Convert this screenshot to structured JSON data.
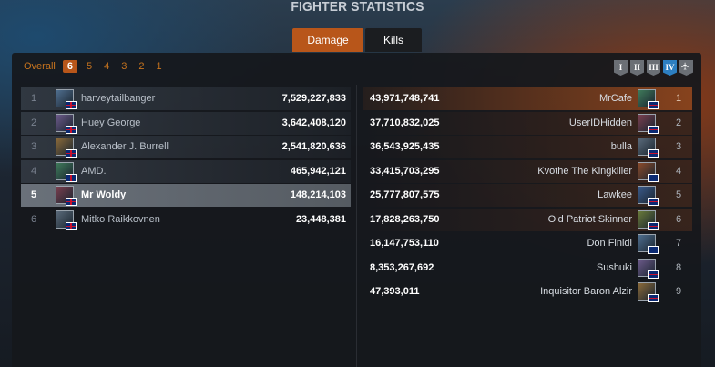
{
  "header": {
    "title": "FIGHTER STATISTICS"
  },
  "tabs": [
    {
      "label": "Damage",
      "active": true
    },
    {
      "label": "Kills",
      "active": false
    }
  ],
  "filters": {
    "overall": "Overall",
    "levels": [
      "6",
      "5",
      "4",
      "3",
      "2",
      "1"
    ],
    "selected": "6"
  },
  "tiers": [
    "I",
    "II",
    "III",
    "IV"
  ],
  "tier_selected": "IV",
  "left_list": [
    {
      "rank": "1",
      "name": "harveytailbanger",
      "value": "7,529,227,833",
      "flag": "uk-flag"
    },
    {
      "rank": "2",
      "name": "Huey George",
      "value": "3,642,408,120",
      "flag": "uk-flag"
    },
    {
      "rank": "3",
      "name": "Alexander J. Burrell",
      "value": "2,541,820,636",
      "flag": "uk-flag"
    },
    {
      "rank": "4",
      "name": "AMD.",
      "value": "465,942,121",
      "flag": "uk-flag"
    },
    {
      "rank": "5",
      "name": "Mr Woldy",
      "value": "148,214,103",
      "flag": "uk-flag",
      "highlighted": true
    },
    {
      "rank": "6",
      "name": "Mitko Raikkovnen",
      "value": "23,448,381",
      "flag": "uk-flag"
    }
  ],
  "right_list": [
    {
      "rank": "1",
      "name": "MrCafe",
      "value": "43,971,748,741",
      "flag": "au-flag"
    },
    {
      "rank": "2",
      "name": "UserIDHidden",
      "value": "37,710,832,025",
      "flag": "au-flag"
    },
    {
      "rank": "3",
      "name": "bulla",
      "value": "36,543,925,435",
      "flag": "au-flag"
    },
    {
      "rank": "4",
      "name": "Kvothe The Kingkiller",
      "value": "33,415,703,295",
      "flag": "au-flag"
    },
    {
      "rank": "5",
      "name": "Lawkee",
      "value": "25,777,807,575",
      "flag": "au-flag"
    },
    {
      "rank": "6",
      "name": "Old Patriot Skinner",
      "value": "17,828,263,750",
      "flag": "au-flag"
    },
    {
      "rank": "7",
      "name": "Don Finidi",
      "value": "16,147,753,110",
      "flag": "au-flag"
    },
    {
      "rank": "8",
      "name": "Sushuki",
      "value": "8,353,267,692",
      "flag": "au-flag"
    },
    {
      "rank": "9",
      "name": "Inquisitor Baron Alzir",
      "value": "47,393,011",
      "flag": "au-flag"
    }
  ],
  "colors": {
    "accent": "#b8561a",
    "tier_active": "#2d7fc1",
    "tier_inactive": "#6b6f75"
  }
}
